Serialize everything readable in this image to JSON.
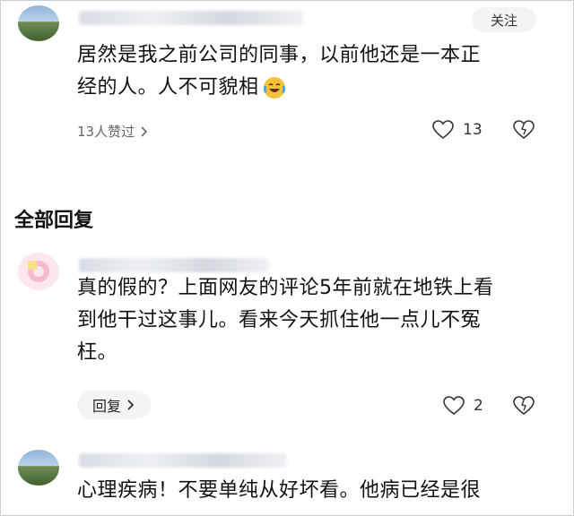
{
  "top_comment": {
    "follow_label": "关注",
    "text_line1": "居然是我之前公司的同事，以前他还是一本正",
    "text_line2": "经的人。人不可貌相",
    "viewed_label": "13人赞过",
    "like_count": "13"
  },
  "replies_section": {
    "title": "全部回复"
  },
  "reply_1": {
    "text_line1": "真的假的？上面网友的评论5年前就在地铁上看",
    "text_line2": "到他干过这事儿。看来今天抓住他一点儿不冤",
    "text_line3": "枉。",
    "reply_label": "回复",
    "like_count": "2"
  },
  "reply_2": {
    "text_line1": "心理疾病！不要单纯从好坏看。他病已经是很"
  },
  "icons": {
    "emoji": "laughing-crying-emoji",
    "heart": "heart-icon",
    "dislike": "dislike-heart-icon",
    "chevron": "chevron-right-icon"
  }
}
